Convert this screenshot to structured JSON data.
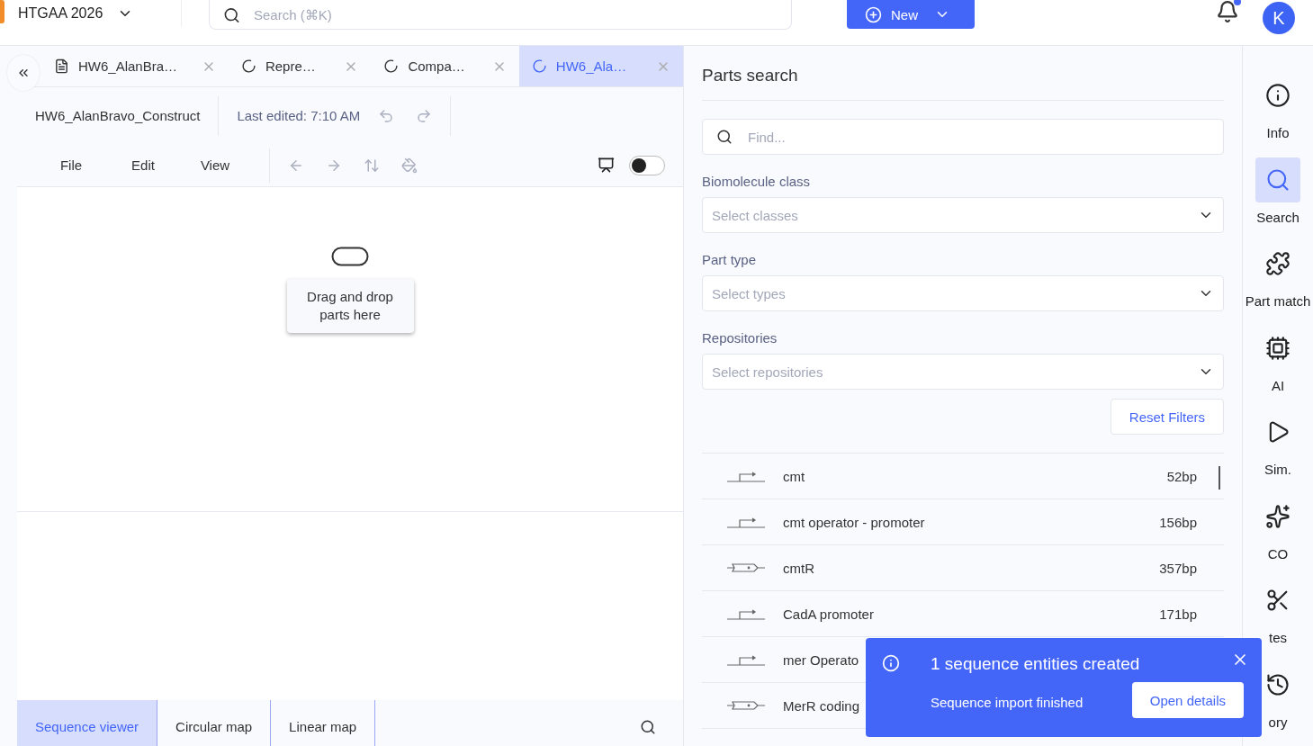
{
  "topbar": {
    "workspace": "HTGAA 2026",
    "search": {
      "placeholder": "Search (⌘K)"
    },
    "new_button": "New",
    "avatar": "K",
    "notifications": {
      "unread": true
    }
  },
  "tabs": [
    {
      "label": "HW6_AlanBra…",
      "kind": "document",
      "selected": false
    },
    {
      "label": "Repre…",
      "kind": "sequence",
      "selected": false
    },
    {
      "label": "Compa…",
      "kind": "sequence",
      "selected": false
    },
    {
      "label": "HW6_Ala…",
      "kind": "sequence",
      "selected": true
    }
  ],
  "document": {
    "title": "HW6_AlanBravo_Construct",
    "last_edited": "Last edited: 7:10 AM",
    "menus": [
      "File",
      "Edit",
      "View"
    ],
    "presentation_on": false
  },
  "canvas": {
    "hint": "Drag and drop parts here"
  },
  "view_tabs": [
    {
      "label": "Sequence viewer",
      "selected": true
    },
    {
      "label": "Circular map",
      "selected": false
    },
    {
      "label": "Linear map",
      "selected": false
    }
  ],
  "parts_search": {
    "title": "Parts search",
    "search": {
      "placeholder": "Find..."
    },
    "filters": [
      {
        "label": "Biomolecule class",
        "placeholder": "Select classes"
      },
      {
        "label": "Part type",
        "placeholder": "Select types"
      },
      {
        "label": "Repositories",
        "placeholder": "Select repositories"
      }
    ],
    "reset_button": "Reset Filters",
    "results": [
      {
        "name": "cmt",
        "length": "52bp",
        "kind": "promoter"
      },
      {
        "name": "cmt operator - promoter",
        "length": "156bp",
        "kind": "promoter"
      },
      {
        "name": "cmtR",
        "length": "357bp",
        "kind": "cds"
      },
      {
        "name": "CadA promoter",
        "length": "171bp",
        "kind": "promoter"
      },
      {
        "name": "mer Operato",
        "kind": "promoter"
      },
      {
        "name": "MerR coding",
        "kind": "cds"
      }
    ]
  },
  "rail": [
    {
      "label": "Info",
      "kind": "info",
      "selected": false
    },
    {
      "label": "Search",
      "kind": "search",
      "selected": true
    },
    {
      "label": "Part match",
      "kind": "puzzle",
      "selected": false
    },
    {
      "label": "AI",
      "kind": "chip",
      "selected": false
    },
    {
      "label": "Sim.",
      "kind": "play",
      "selected": false
    },
    {
      "label": "CO",
      "kind": "sparkle",
      "selected": false
    },
    {
      "label": "tes",
      "kind": "scissors",
      "selected": false
    },
    {
      "label": "ory",
      "kind": "history",
      "selected": false
    }
  ],
  "toast": {
    "title": "1 sequence entities created",
    "message": "Sequence import finished",
    "action": "Open details"
  }
}
